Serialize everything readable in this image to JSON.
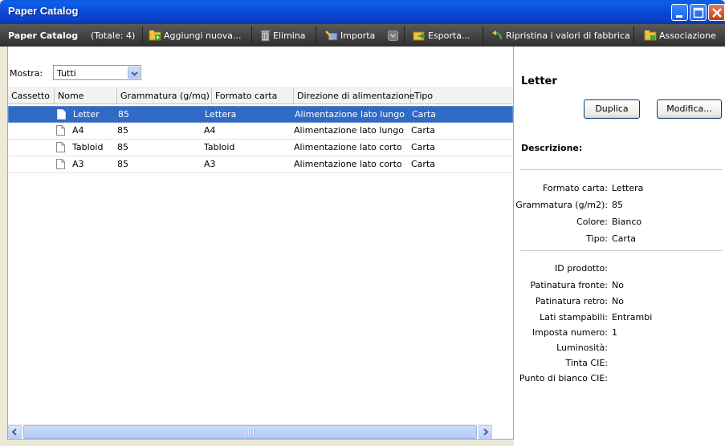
{
  "window": {
    "title": "Paper Catalog"
  },
  "toolbar": {
    "catalog_label": "Paper Catalog",
    "total": "(Totale: 4)",
    "add_new": "Aggiungi nuova...",
    "delete": "Elimina",
    "import": "Importa",
    "export": "Esporta...",
    "restore": "Ripristina i valori di fabbrica",
    "association": "Associazione"
  },
  "filter": {
    "label": "Mostra:",
    "value": "Tutti"
  },
  "columns": [
    "Cassetto",
    "Nome",
    "Grammatura (g/mq)",
    "Formato carta",
    "Direzione di alimentazione",
    "Tipo"
  ],
  "rows": [
    {
      "cassetto": "",
      "nome": "Letter",
      "grammatura": "85",
      "formato": "Lettera",
      "direzione": "Alimentazione lato lungo",
      "tipo": "Carta",
      "selected": true
    },
    {
      "cassetto": "",
      "nome": "A4",
      "grammatura": "85",
      "formato": "A4",
      "direzione": "Alimentazione lato lungo",
      "tipo": "Carta"
    },
    {
      "cassetto": "",
      "nome": "Tabloid",
      "grammatura": "85",
      "formato": "Tabloid",
      "direzione": "Alimentazione lato corto",
      "tipo": "Carta"
    },
    {
      "cassetto": "",
      "nome": "A3",
      "grammatura": "85",
      "formato": "A3",
      "direzione": "Alimentazione lato corto",
      "tipo": "Carta"
    }
  ],
  "details": {
    "title": "Letter",
    "duplicate": "Duplica",
    "modify": "Modifica...",
    "description_label": "Descrizione:",
    "props1": [
      {
        "k": "Formato carta:",
        "v": "Lettera"
      },
      {
        "k": "Grammatura (g/m2):",
        "v": "85"
      },
      {
        "k": "Colore:",
        "v": "Bianco"
      },
      {
        "k": "Tipo:",
        "v": "Carta"
      }
    ],
    "props2": [
      {
        "k": "ID prodotto:",
        "v": ""
      },
      {
        "k": "Patinatura fronte:",
        "v": "No"
      },
      {
        "k": "Patinatura retro:",
        "v": "No"
      },
      {
        "k": "Lati stampabili:",
        "v": "Entrambi"
      },
      {
        "k": "Imposta numero:",
        "v": "1"
      },
      {
        "k": "Luminosità:",
        "v": ""
      },
      {
        "k": "Tinta CIE:",
        "v": ""
      },
      {
        "k": "Punto di bianco CIE:",
        "v": ""
      }
    ]
  },
  "colors": {
    "selection": "#316ac5",
    "titlebar": "#0b48d4",
    "toolbar": "#3a3a3a"
  }
}
